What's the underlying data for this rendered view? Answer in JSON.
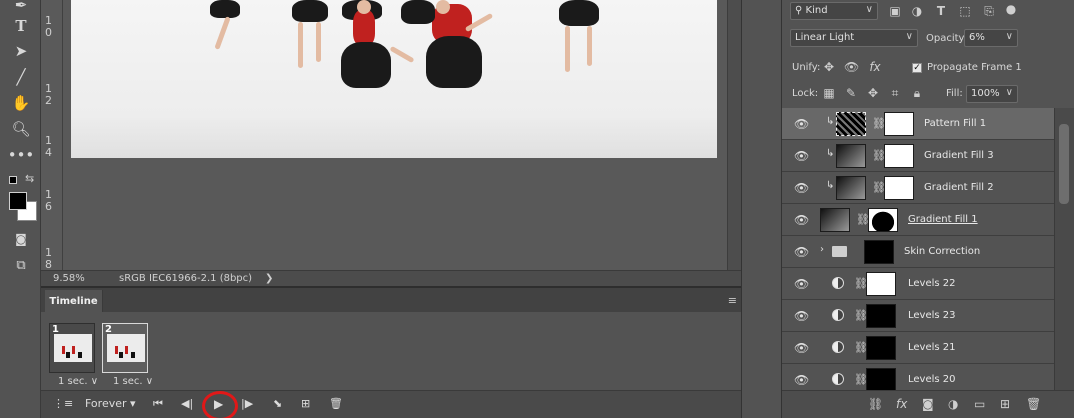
{
  "toolbar": {
    "tools": [
      "pen-tool",
      "type-tool",
      "path-selection-tool",
      "line-tool",
      "hand-tool",
      "zoom-tool",
      "more-tools",
      "quick-mask",
      "screen-mode"
    ]
  },
  "document": {
    "ruler_ticks": [
      "1",
      "0",
      "1",
      "2",
      "1",
      "4",
      "1",
      "6",
      "1",
      "8"
    ],
    "zoom": "9.58%",
    "color_profile": "sRGB IEC61966-2.1 (8bpc)",
    "status_arrow": "❯"
  },
  "timeline": {
    "tab_label": "Timeline",
    "frames": [
      {
        "number": "1",
        "delay": "1 sec.",
        "selected": false
      },
      {
        "number": "2",
        "delay": "1 sec.",
        "selected": true
      }
    ],
    "loop_option": "Forever",
    "controls": {
      "first": "⏮",
      "prev": "◀|",
      "play": "▶",
      "next": "|▶",
      "tween": "⬊",
      "new_frame": "⊞",
      "delete": "🗑"
    }
  },
  "layers_panel": {
    "filter_kind": "Kind",
    "blend_mode": "Linear Light",
    "opacity_label": "Opacity:",
    "opacity_value": "6%",
    "unify_label": "Unify:",
    "propagate_label": "Propagate Frame 1",
    "lock_label": "Lock:",
    "fill_label": "Fill:",
    "fill_value": "100%",
    "layers": [
      {
        "name": "Pattern Fill 1",
        "type": "pattern",
        "clipped": true,
        "active": true
      },
      {
        "name": "Gradient Fill 3",
        "type": "gradient",
        "clipped": true,
        "active": false
      },
      {
        "name": "Gradient Fill 2",
        "type": "gradient",
        "clipped": true,
        "active": false
      },
      {
        "name": "Gradient Fill 1",
        "type": "gradient-base",
        "clipped": false,
        "active": false
      },
      {
        "name": "Skin Correction",
        "type": "group",
        "clipped": false,
        "active": false
      },
      {
        "name": "Levels 22",
        "type": "levels-white",
        "clipped": false,
        "active": false
      },
      {
        "name": "Levels 23",
        "type": "levels-black",
        "clipped": false,
        "active": false
      },
      {
        "name": "Levels 21",
        "type": "levels-black",
        "clipped": false,
        "active": false
      },
      {
        "name": "Levels 20",
        "type": "levels-black",
        "clipped": false,
        "active": false
      }
    ],
    "footer_icons": [
      "link-icon",
      "fx-icon",
      "mask-icon",
      "adjustment-icon",
      "folder-icon",
      "new-layer-icon",
      "trash-icon"
    ]
  }
}
